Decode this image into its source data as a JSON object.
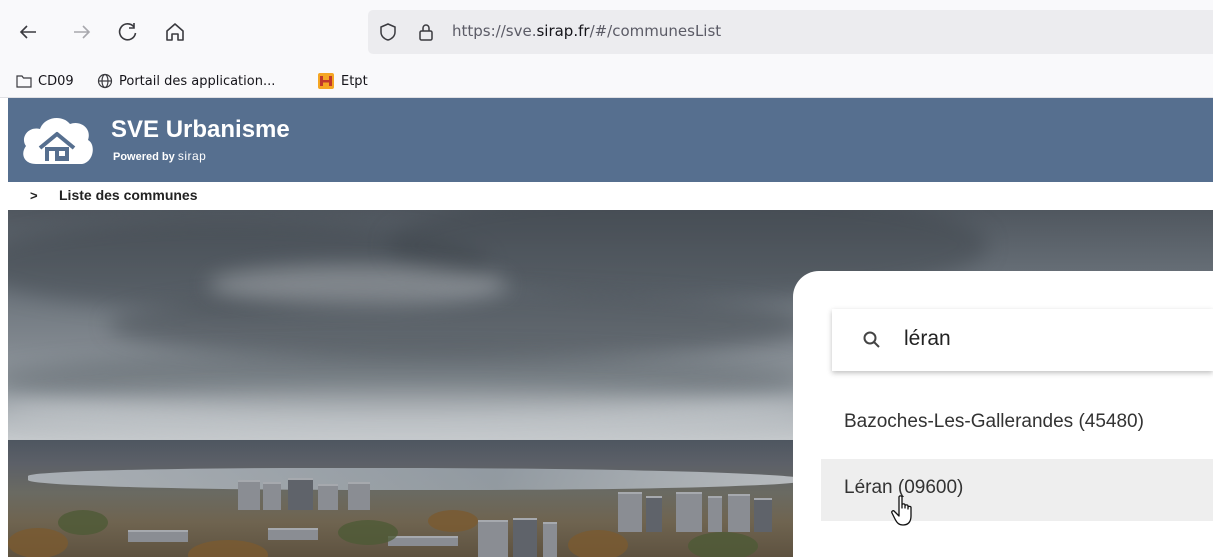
{
  "browser": {
    "url_prefix": "https://sve.",
    "url_domain": "sirap.fr",
    "url_path": "/#/communesList",
    "nav": {
      "back_icon": "arrow-left-icon",
      "forward_icon": "arrow-right-icon",
      "reload_icon": "reload-icon",
      "home_icon": "home-icon"
    }
  },
  "bookmarks": [
    {
      "label": "CD09",
      "icon": "folder-icon"
    },
    {
      "label": "Portail des application...",
      "icon": "globe-icon"
    },
    {
      "label": "Etpt",
      "icon": "app-icon"
    }
  ],
  "app": {
    "title": "SVE Urbanisme",
    "powered_by": "Powered by",
    "brand": "sirap",
    "header_color": "#566f8f"
  },
  "breadcrumb": {
    "arrow": ">",
    "label": "Liste des communes"
  },
  "search": {
    "value": "léran"
  },
  "results": [
    {
      "label": "Bazoches-Les-Gallerandes (45480)"
    },
    {
      "label": "Léran (09600)"
    }
  ]
}
